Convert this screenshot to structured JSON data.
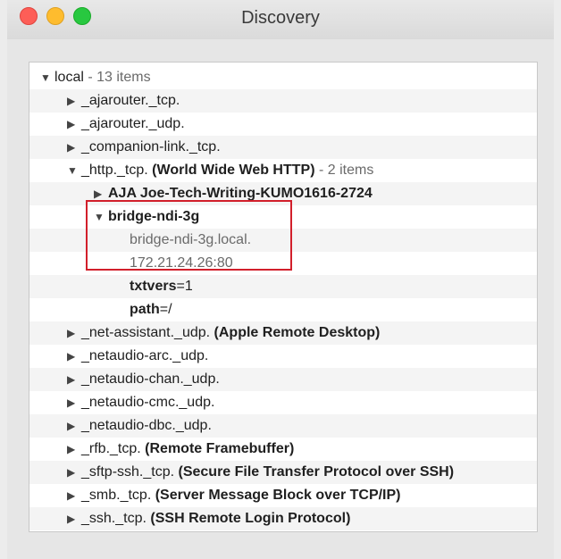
{
  "window": {
    "title": "Discovery"
  },
  "tree": {
    "root": {
      "name": "local",
      "count_suffix": " - 13 items"
    },
    "items": [
      {
        "name": "_ajarouter._tcp."
      },
      {
        "name": "_ajarouter._udp."
      },
      {
        "name": "_companion-link._tcp."
      },
      {
        "name": "_http._tcp.",
        "desc": "(World Wide Web HTTP)",
        "count_suffix": " - 2 items"
      },
      {
        "name": "AJA Joe-Tech-Writing-KUMO1616-2724"
      },
      {
        "name": "bridge-ndi-3g"
      },
      {
        "name": "bridge-ndi-3g.local."
      },
      {
        "name": "172.21.24.26:80"
      },
      {
        "key": "txtvers",
        "value": "=1"
      },
      {
        "key": "path",
        "value": "=/"
      },
      {
        "name": "_net-assistant._udp.",
        "desc": "(Apple Remote Desktop)"
      },
      {
        "name": "_netaudio-arc._udp."
      },
      {
        "name": "_netaudio-chan._udp."
      },
      {
        "name": "_netaudio-cmc._udp."
      },
      {
        "name": "_netaudio-dbc._udp."
      },
      {
        "name": "_rfb._tcp.",
        "desc": "(Remote Framebuffer)"
      },
      {
        "name": "_sftp-ssh._tcp.",
        "desc": "(Secure File Transfer Protocol over SSH)"
      },
      {
        "name": "_smb._tcp.",
        "desc": "(Server Message Block over TCP/IP)"
      },
      {
        "name": "_ssh._tcp.",
        "desc": "(SSH Remote Login Protocol)"
      }
    ]
  },
  "colors": {
    "highlight_border": "#d21f2b"
  }
}
